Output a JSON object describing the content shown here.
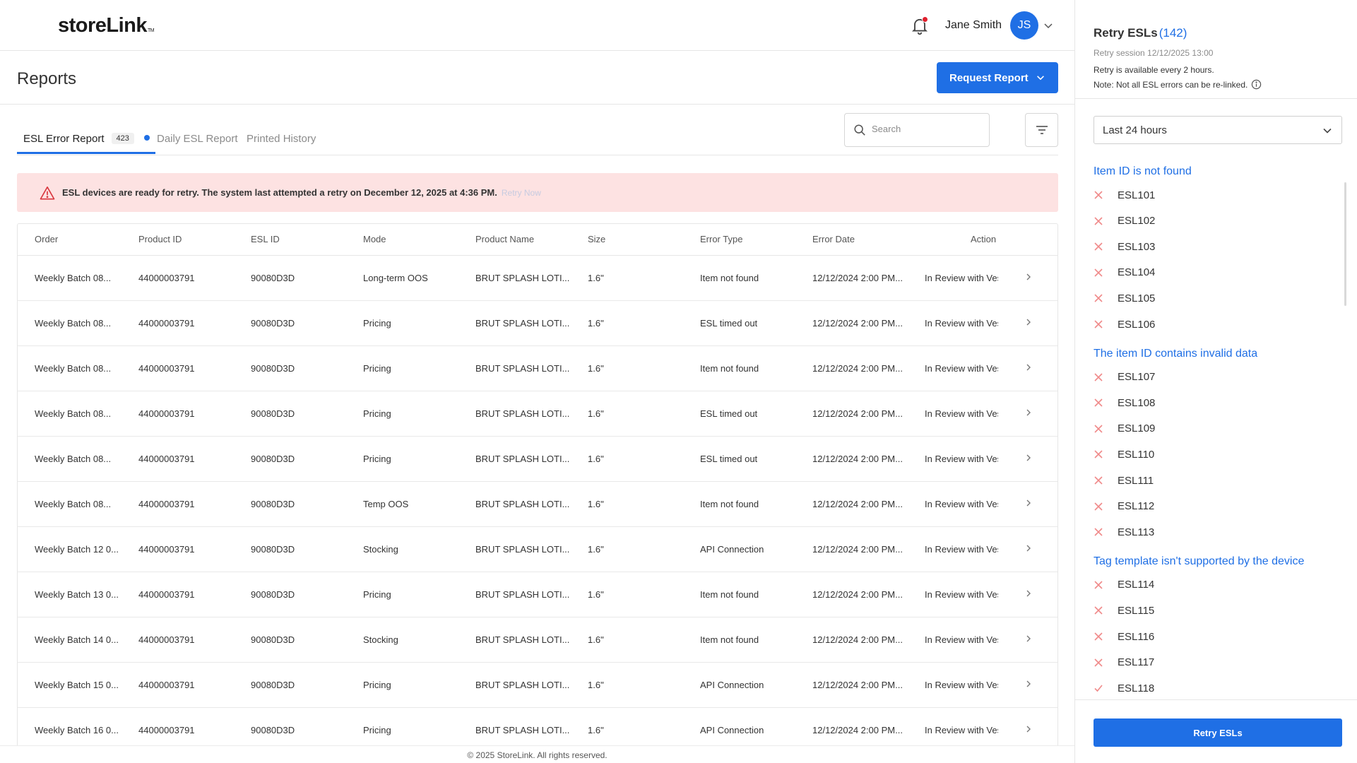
{
  "app": {
    "logo": "storeLink",
    "logo_tm": "TM",
    "user_name": "Jane Smith",
    "avatar_initials": "JS"
  },
  "page": {
    "title": "Reports",
    "request_button": "Request Report"
  },
  "tabs": [
    {
      "label": "ESL Error Report",
      "badge": "423",
      "active": true
    },
    {
      "label": "Daily ESL Report",
      "active": false
    },
    {
      "label": "Printed History",
      "active": false
    }
  ],
  "search": {
    "placeholder": "Search"
  },
  "alert": {
    "text": "ESL devices are ready for retry. The system last attempted a retry on December 12, 2025 at 4:36 PM.",
    "link": "Retry Now"
  },
  "table": {
    "columns": [
      "Order",
      "Product ID",
      "ESL ID",
      "Mode",
      "Product Name",
      "Size",
      "Error Type",
      "Error Date",
      "Action"
    ],
    "rows": [
      [
        "Weekly Batch 08...",
        "44000003791",
        "90080D3D",
        "Long-term OOS",
        "BRUT SPLASH LOTI...",
        "1.6\"",
        "Item not found",
        "12/12/2024 2:00 PM...",
        "In Review with Ves..."
      ],
      [
        "Weekly Batch 08...",
        "44000003791",
        "90080D3D",
        "Pricing",
        "BRUT SPLASH LOTI...",
        "1.6\"",
        "ESL timed out",
        "12/12/2024 2:00 PM...",
        "In Review with Ves..."
      ],
      [
        "Weekly Batch 08...",
        "44000003791",
        "90080D3D",
        "Pricing",
        "BRUT SPLASH LOTI...",
        "1.6\"",
        "Item not found",
        "12/12/2024 2:00 PM...",
        "In Review with Ves..."
      ],
      [
        "Weekly Batch 08...",
        "44000003791",
        "90080D3D",
        "Pricing",
        "BRUT SPLASH LOTI...",
        "1.6\"",
        "ESL timed out",
        "12/12/2024 2:00 PM...",
        "In Review with Ves..."
      ],
      [
        "Weekly Batch 08...",
        "44000003791",
        "90080D3D",
        "Pricing",
        "BRUT SPLASH LOTI...",
        "1.6\"",
        "ESL timed out",
        "12/12/2024 2:00 PM...",
        "In Review with Ves..."
      ],
      [
        "Weekly Batch 08...",
        "44000003791",
        "90080D3D",
        "Temp OOS",
        "BRUT SPLASH LOTI...",
        "1.6\"",
        "Item not found",
        "12/12/2024 2:00 PM...",
        "In Review with Ves..."
      ],
      [
        "Weekly Batch 12 0...",
        "44000003791",
        "90080D3D",
        "Stocking",
        "BRUT SPLASH LOTI...",
        "1.6\"",
        "API Connection",
        "12/12/2024 2:00 PM...",
        "In Review with Ves..."
      ],
      [
        "Weekly Batch 13 0...",
        "44000003791",
        "90080D3D",
        "Pricing",
        "BRUT SPLASH LOTI...",
        "1.6\"",
        "Item not found",
        "12/12/2024 2:00 PM...",
        "In Review with Ves..."
      ],
      [
        "Weekly Batch 14 0...",
        "44000003791",
        "90080D3D",
        "Stocking",
        "BRUT SPLASH LOTI...",
        "1.6\"",
        "Item not found",
        "12/12/2024 2:00 PM...",
        "In Review with Ves..."
      ],
      [
        "Weekly Batch 15 0...",
        "44000003791",
        "90080D3D",
        "Pricing",
        "BRUT SPLASH LOTI...",
        "1.6\"",
        "API Connection",
        "12/12/2024 2:00 PM...",
        "In Review with Ves..."
      ],
      [
        "Weekly Batch 16 0...",
        "44000003791",
        "90080D3D",
        "Pricing",
        "BRUT SPLASH LOTI...",
        "1.6\"",
        "API Connection",
        "12/12/2024 2:00 PM...",
        "In Review with Ves..."
      ]
    ]
  },
  "footer": {
    "text": "© 2025 StoreLink. All rights reserved."
  },
  "panel": {
    "title": "Retry ESLs",
    "count": "(142)",
    "session": "Retry session 12/12/2025 13:00",
    "note1": "Retry is available every 2 hours.",
    "note2": "Note: Not all ESL errors can be re-linked.",
    "range": "Last 24 hours",
    "groups": [
      {
        "title": "Item ID is not found",
        "items": [
          "ESL101",
          "ESL102",
          "ESL103",
          "ESL104",
          "ESL105",
          "ESL106"
        ]
      },
      {
        "title": "The item ID contains invalid data",
        "items": [
          "ESL107",
          "ESL108",
          "ESL109",
          "ESL110",
          "ESL111",
          "ESL112",
          "ESL113"
        ]
      },
      {
        "title": "Tag template isn't supported by the device",
        "items": [
          "ESL114",
          "ESL115",
          "ESL116",
          "ESL117",
          "ESL118"
        ]
      }
    ],
    "retry_button": "Retry ESLs"
  },
  "colors": {
    "accent": "#1f6fe5",
    "alert_bg": "#fde2e2",
    "error_x": "#f08a8a"
  }
}
